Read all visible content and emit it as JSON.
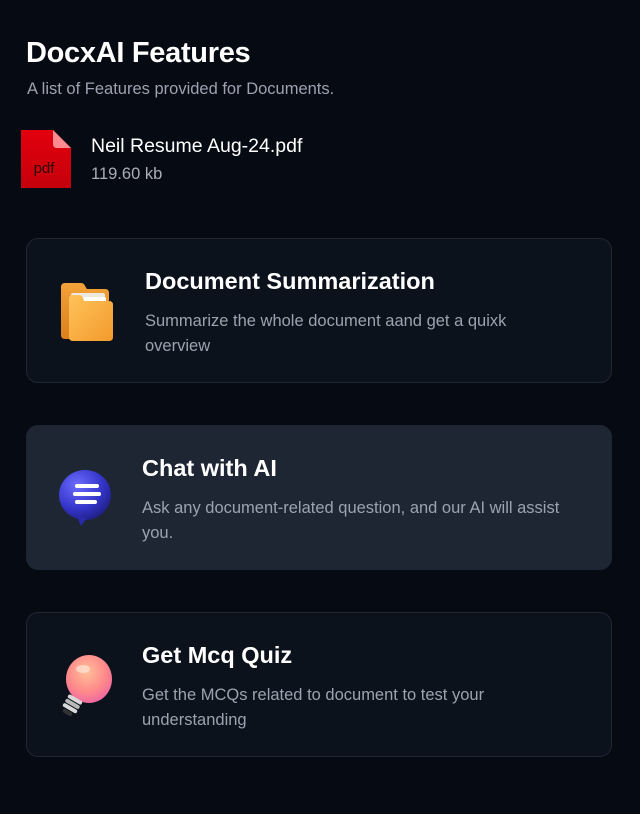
{
  "header": {
    "title": "DocxAI Features",
    "subtitle": "A list of Features provided for Documents."
  },
  "file": {
    "icon": "pdf-file-icon",
    "icon_label": "pdf",
    "name": "Neil Resume Aug-24.pdf",
    "size": "119.60 kb"
  },
  "features": [
    {
      "icon": "folder-icon",
      "title": "Document Summarization",
      "description": "Summarize the whole document aand get a quixk overview"
    },
    {
      "icon": "chat-bubble-icon",
      "title": "Chat with AI",
      "description": "Ask any document-related question, and our AI will assist you."
    },
    {
      "icon": "lightbulb-icon",
      "title": "Get Mcq Quiz",
      "description": "Get the MCQs related to document to test your understanding"
    }
  ],
  "colors": {
    "background": "#060a12",
    "card_background": "#0c121c",
    "card_active_background": "#1e2633",
    "card_border": "#1f2733",
    "pdf_red": "#d9000d",
    "muted_text": "#9ba3b0"
  }
}
